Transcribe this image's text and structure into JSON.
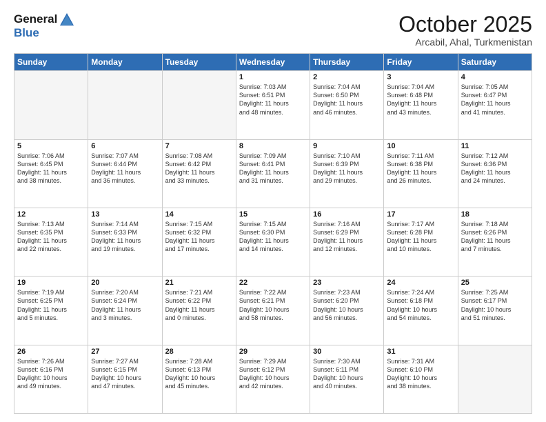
{
  "header": {
    "logo_general": "General",
    "logo_blue": "Blue",
    "month_title": "October 2025",
    "subtitle": "Arcabil, Ahal, Turkmenistan"
  },
  "weekdays": [
    "Sunday",
    "Monday",
    "Tuesday",
    "Wednesday",
    "Thursday",
    "Friday",
    "Saturday"
  ],
  "weeks": [
    [
      {
        "day": "",
        "info": ""
      },
      {
        "day": "",
        "info": ""
      },
      {
        "day": "",
        "info": ""
      },
      {
        "day": "1",
        "info": "Sunrise: 7:03 AM\nSunset: 6:51 PM\nDaylight: 11 hours\nand 48 minutes."
      },
      {
        "day": "2",
        "info": "Sunrise: 7:04 AM\nSunset: 6:50 PM\nDaylight: 11 hours\nand 46 minutes."
      },
      {
        "day": "3",
        "info": "Sunrise: 7:04 AM\nSunset: 6:48 PM\nDaylight: 11 hours\nand 43 minutes."
      },
      {
        "day": "4",
        "info": "Sunrise: 7:05 AM\nSunset: 6:47 PM\nDaylight: 11 hours\nand 41 minutes."
      }
    ],
    [
      {
        "day": "5",
        "info": "Sunrise: 7:06 AM\nSunset: 6:45 PM\nDaylight: 11 hours\nand 38 minutes."
      },
      {
        "day": "6",
        "info": "Sunrise: 7:07 AM\nSunset: 6:44 PM\nDaylight: 11 hours\nand 36 minutes."
      },
      {
        "day": "7",
        "info": "Sunrise: 7:08 AM\nSunset: 6:42 PM\nDaylight: 11 hours\nand 33 minutes."
      },
      {
        "day": "8",
        "info": "Sunrise: 7:09 AM\nSunset: 6:41 PM\nDaylight: 11 hours\nand 31 minutes."
      },
      {
        "day": "9",
        "info": "Sunrise: 7:10 AM\nSunset: 6:39 PM\nDaylight: 11 hours\nand 29 minutes."
      },
      {
        "day": "10",
        "info": "Sunrise: 7:11 AM\nSunset: 6:38 PM\nDaylight: 11 hours\nand 26 minutes."
      },
      {
        "day": "11",
        "info": "Sunrise: 7:12 AM\nSunset: 6:36 PM\nDaylight: 11 hours\nand 24 minutes."
      }
    ],
    [
      {
        "day": "12",
        "info": "Sunrise: 7:13 AM\nSunset: 6:35 PM\nDaylight: 11 hours\nand 22 minutes."
      },
      {
        "day": "13",
        "info": "Sunrise: 7:14 AM\nSunset: 6:33 PM\nDaylight: 11 hours\nand 19 minutes."
      },
      {
        "day": "14",
        "info": "Sunrise: 7:15 AM\nSunset: 6:32 PM\nDaylight: 11 hours\nand 17 minutes."
      },
      {
        "day": "15",
        "info": "Sunrise: 7:15 AM\nSunset: 6:30 PM\nDaylight: 11 hours\nand 14 minutes."
      },
      {
        "day": "16",
        "info": "Sunrise: 7:16 AM\nSunset: 6:29 PM\nDaylight: 11 hours\nand 12 minutes."
      },
      {
        "day": "17",
        "info": "Sunrise: 7:17 AM\nSunset: 6:28 PM\nDaylight: 11 hours\nand 10 minutes."
      },
      {
        "day": "18",
        "info": "Sunrise: 7:18 AM\nSunset: 6:26 PM\nDaylight: 11 hours\nand 7 minutes."
      }
    ],
    [
      {
        "day": "19",
        "info": "Sunrise: 7:19 AM\nSunset: 6:25 PM\nDaylight: 11 hours\nand 5 minutes."
      },
      {
        "day": "20",
        "info": "Sunrise: 7:20 AM\nSunset: 6:24 PM\nDaylight: 11 hours\nand 3 minutes."
      },
      {
        "day": "21",
        "info": "Sunrise: 7:21 AM\nSunset: 6:22 PM\nDaylight: 11 hours\nand 0 minutes."
      },
      {
        "day": "22",
        "info": "Sunrise: 7:22 AM\nSunset: 6:21 PM\nDaylight: 10 hours\nand 58 minutes."
      },
      {
        "day": "23",
        "info": "Sunrise: 7:23 AM\nSunset: 6:20 PM\nDaylight: 10 hours\nand 56 minutes."
      },
      {
        "day": "24",
        "info": "Sunrise: 7:24 AM\nSunset: 6:18 PM\nDaylight: 10 hours\nand 54 minutes."
      },
      {
        "day": "25",
        "info": "Sunrise: 7:25 AM\nSunset: 6:17 PM\nDaylight: 10 hours\nand 51 minutes."
      }
    ],
    [
      {
        "day": "26",
        "info": "Sunrise: 7:26 AM\nSunset: 6:16 PM\nDaylight: 10 hours\nand 49 minutes."
      },
      {
        "day": "27",
        "info": "Sunrise: 7:27 AM\nSunset: 6:15 PM\nDaylight: 10 hours\nand 47 minutes."
      },
      {
        "day": "28",
        "info": "Sunrise: 7:28 AM\nSunset: 6:13 PM\nDaylight: 10 hours\nand 45 minutes."
      },
      {
        "day": "29",
        "info": "Sunrise: 7:29 AM\nSunset: 6:12 PM\nDaylight: 10 hours\nand 42 minutes."
      },
      {
        "day": "30",
        "info": "Sunrise: 7:30 AM\nSunset: 6:11 PM\nDaylight: 10 hours\nand 40 minutes."
      },
      {
        "day": "31",
        "info": "Sunrise: 7:31 AM\nSunset: 6:10 PM\nDaylight: 10 hours\nand 38 minutes."
      },
      {
        "day": "",
        "info": ""
      }
    ]
  ]
}
